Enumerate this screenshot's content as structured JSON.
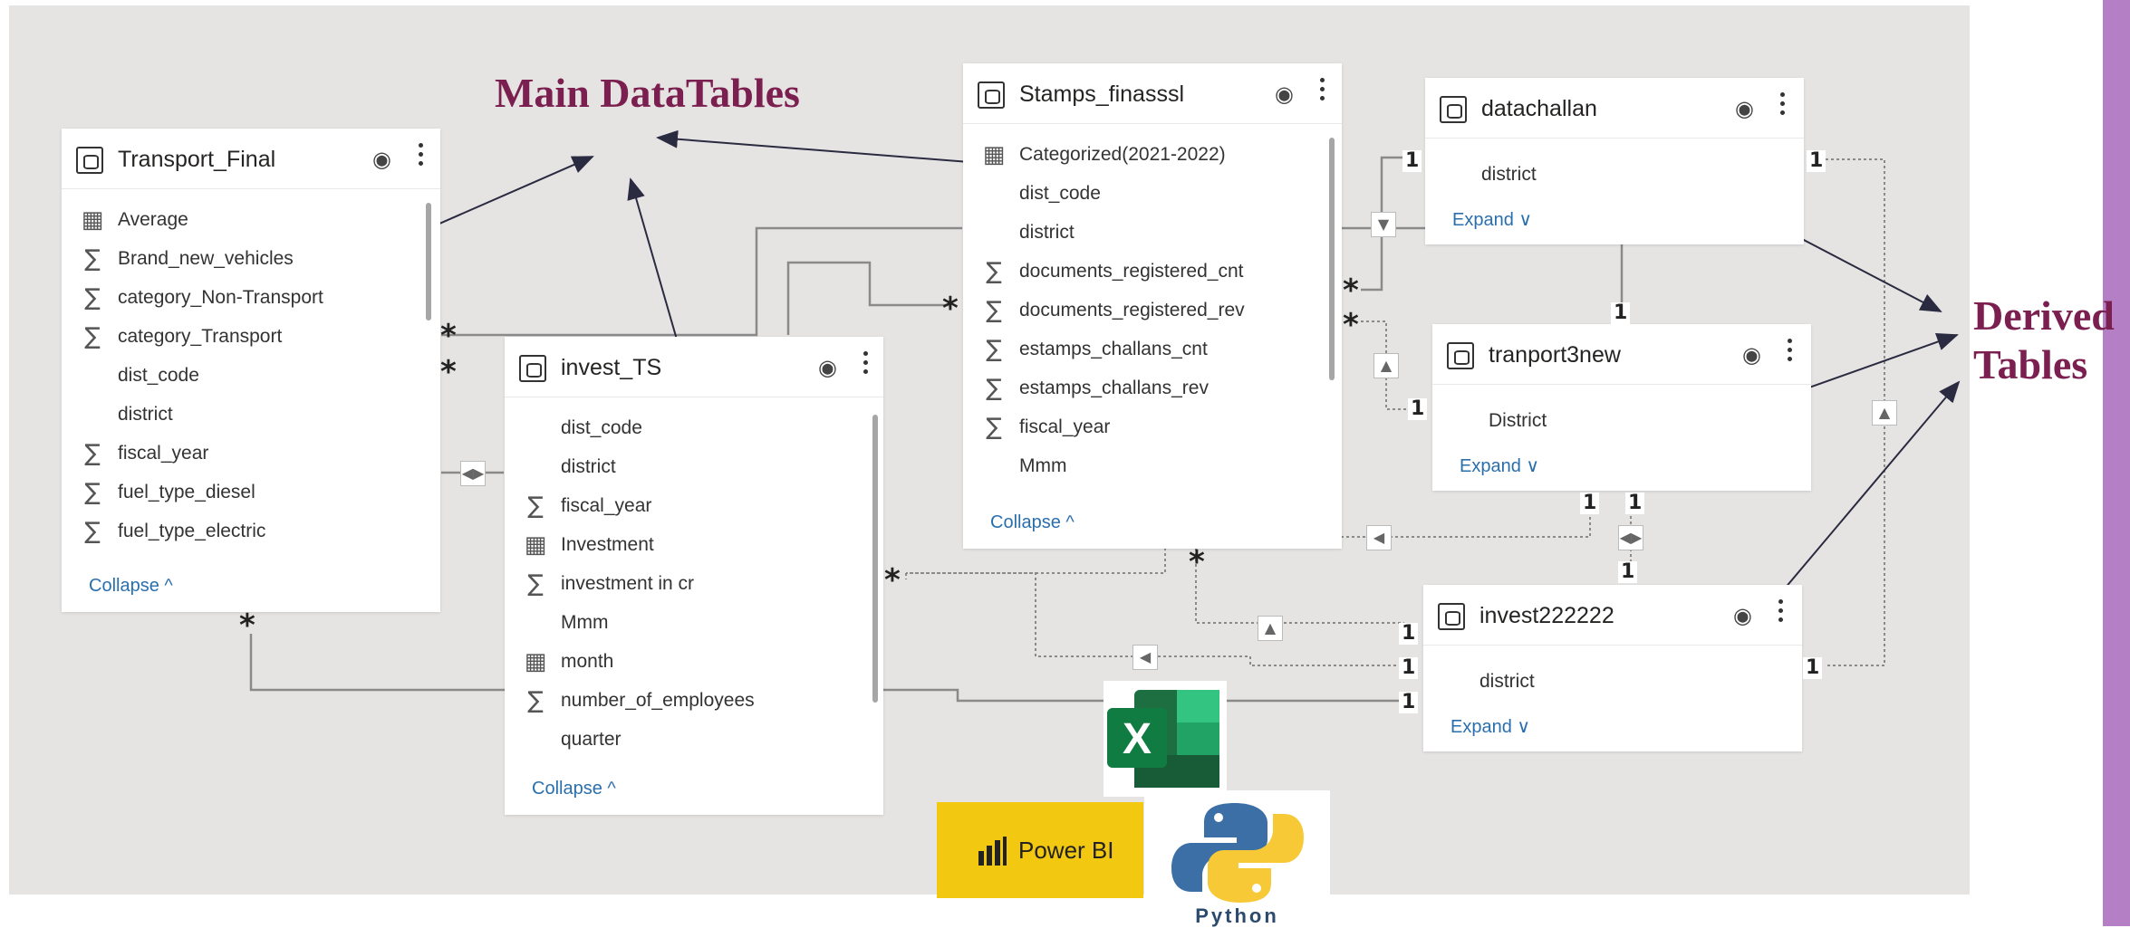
{
  "annotations": {
    "main_tables": "Main DataTables",
    "derived_line1": "Derived",
    "derived_line2": "Tables"
  },
  "tables": {
    "transport_final": {
      "title": "Transport_Final",
      "fields": [
        {
          "icon": "table-icon",
          "name": "Average"
        },
        {
          "icon": "sigma-icon",
          "name": "Brand_new_vehicles"
        },
        {
          "icon": "sigma-icon",
          "name": "category_Non-Transport"
        },
        {
          "icon": "sigma-icon",
          "name": "category_Transport"
        },
        {
          "icon": "",
          "name": "dist_code"
        },
        {
          "icon": "",
          "name": "district"
        },
        {
          "icon": "sigma-icon",
          "name": "fiscal_year"
        },
        {
          "icon": "sigma-icon",
          "name": "fuel_type_diesel"
        },
        {
          "icon": "sigma-icon",
          "name": "fuel_type_electric"
        }
      ],
      "toggle": "Collapse ^"
    },
    "invest_ts": {
      "title": "invest_TS",
      "fields": [
        {
          "icon": "",
          "name": "dist_code"
        },
        {
          "icon": "",
          "name": "district"
        },
        {
          "icon": "sigma-icon",
          "name": "fiscal_year"
        },
        {
          "icon": "table-icon",
          "name": "Investment"
        },
        {
          "icon": "sigma-icon",
          "name": "investment in cr"
        },
        {
          "icon": "",
          "name": "Mmm"
        },
        {
          "icon": "calendar-icon",
          "name": "month"
        },
        {
          "icon": "sigma-icon",
          "name": "number_of_employees"
        },
        {
          "icon": "",
          "name": "quarter"
        }
      ],
      "toggle": "Collapse ^"
    },
    "stamps_finasssl": {
      "title": "Stamps_finasssl",
      "fields": [
        {
          "icon": "table-icon",
          "name": "Categorized(2021-2022)"
        },
        {
          "icon": "",
          "name": "dist_code"
        },
        {
          "icon": "",
          "name": "district"
        },
        {
          "icon": "sigma-icon",
          "name": "documents_registered_cnt"
        },
        {
          "icon": "sigma-icon",
          "name": "documents_registered_rev"
        },
        {
          "icon": "sigma-icon",
          "name": "estamps_challans_cnt"
        },
        {
          "icon": "sigma-icon",
          "name": "estamps_challans_rev"
        },
        {
          "icon": "sigma-icon",
          "name": "fiscal_year"
        },
        {
          "icon": "",
          "name": "Mmm"
        }
      ],
      "toggle": "Collapse ^"
    },
    "datachallan": {
      "title": "datachallan",
      "fields": [
        {
          "icon": "",
          "name": "district"
        }
      ],
      "toggle": "Expand ∨"
    },
    "tranport3new": {
      "title": "tranport3new",
      "fields": [
        {
          "icon": "",
          "name": "District"
        }
      ],
      "toggle": "Expand ∨"
    },
    "invest222222": {
      "title": "invest222222",
      "fields": [
        {
          "icon": "",
          "name": "district"
        }
      ],
      "toggle": "Expand ∨"
    }
  },
  "cardinality": {
    "one": "1",
    "many": "*"
  },
  "logos": {
    "powerbi": "Power BI",
    "python": "Python"
  },
  "colors": {
    "canvas": "#e6e4e2",
    "annotation": "#7a1f4f",
    "link": "#2a6fad",
    "side_bar": "#b57fc6",
    "powerbi": "#f2c811"
  }
}
